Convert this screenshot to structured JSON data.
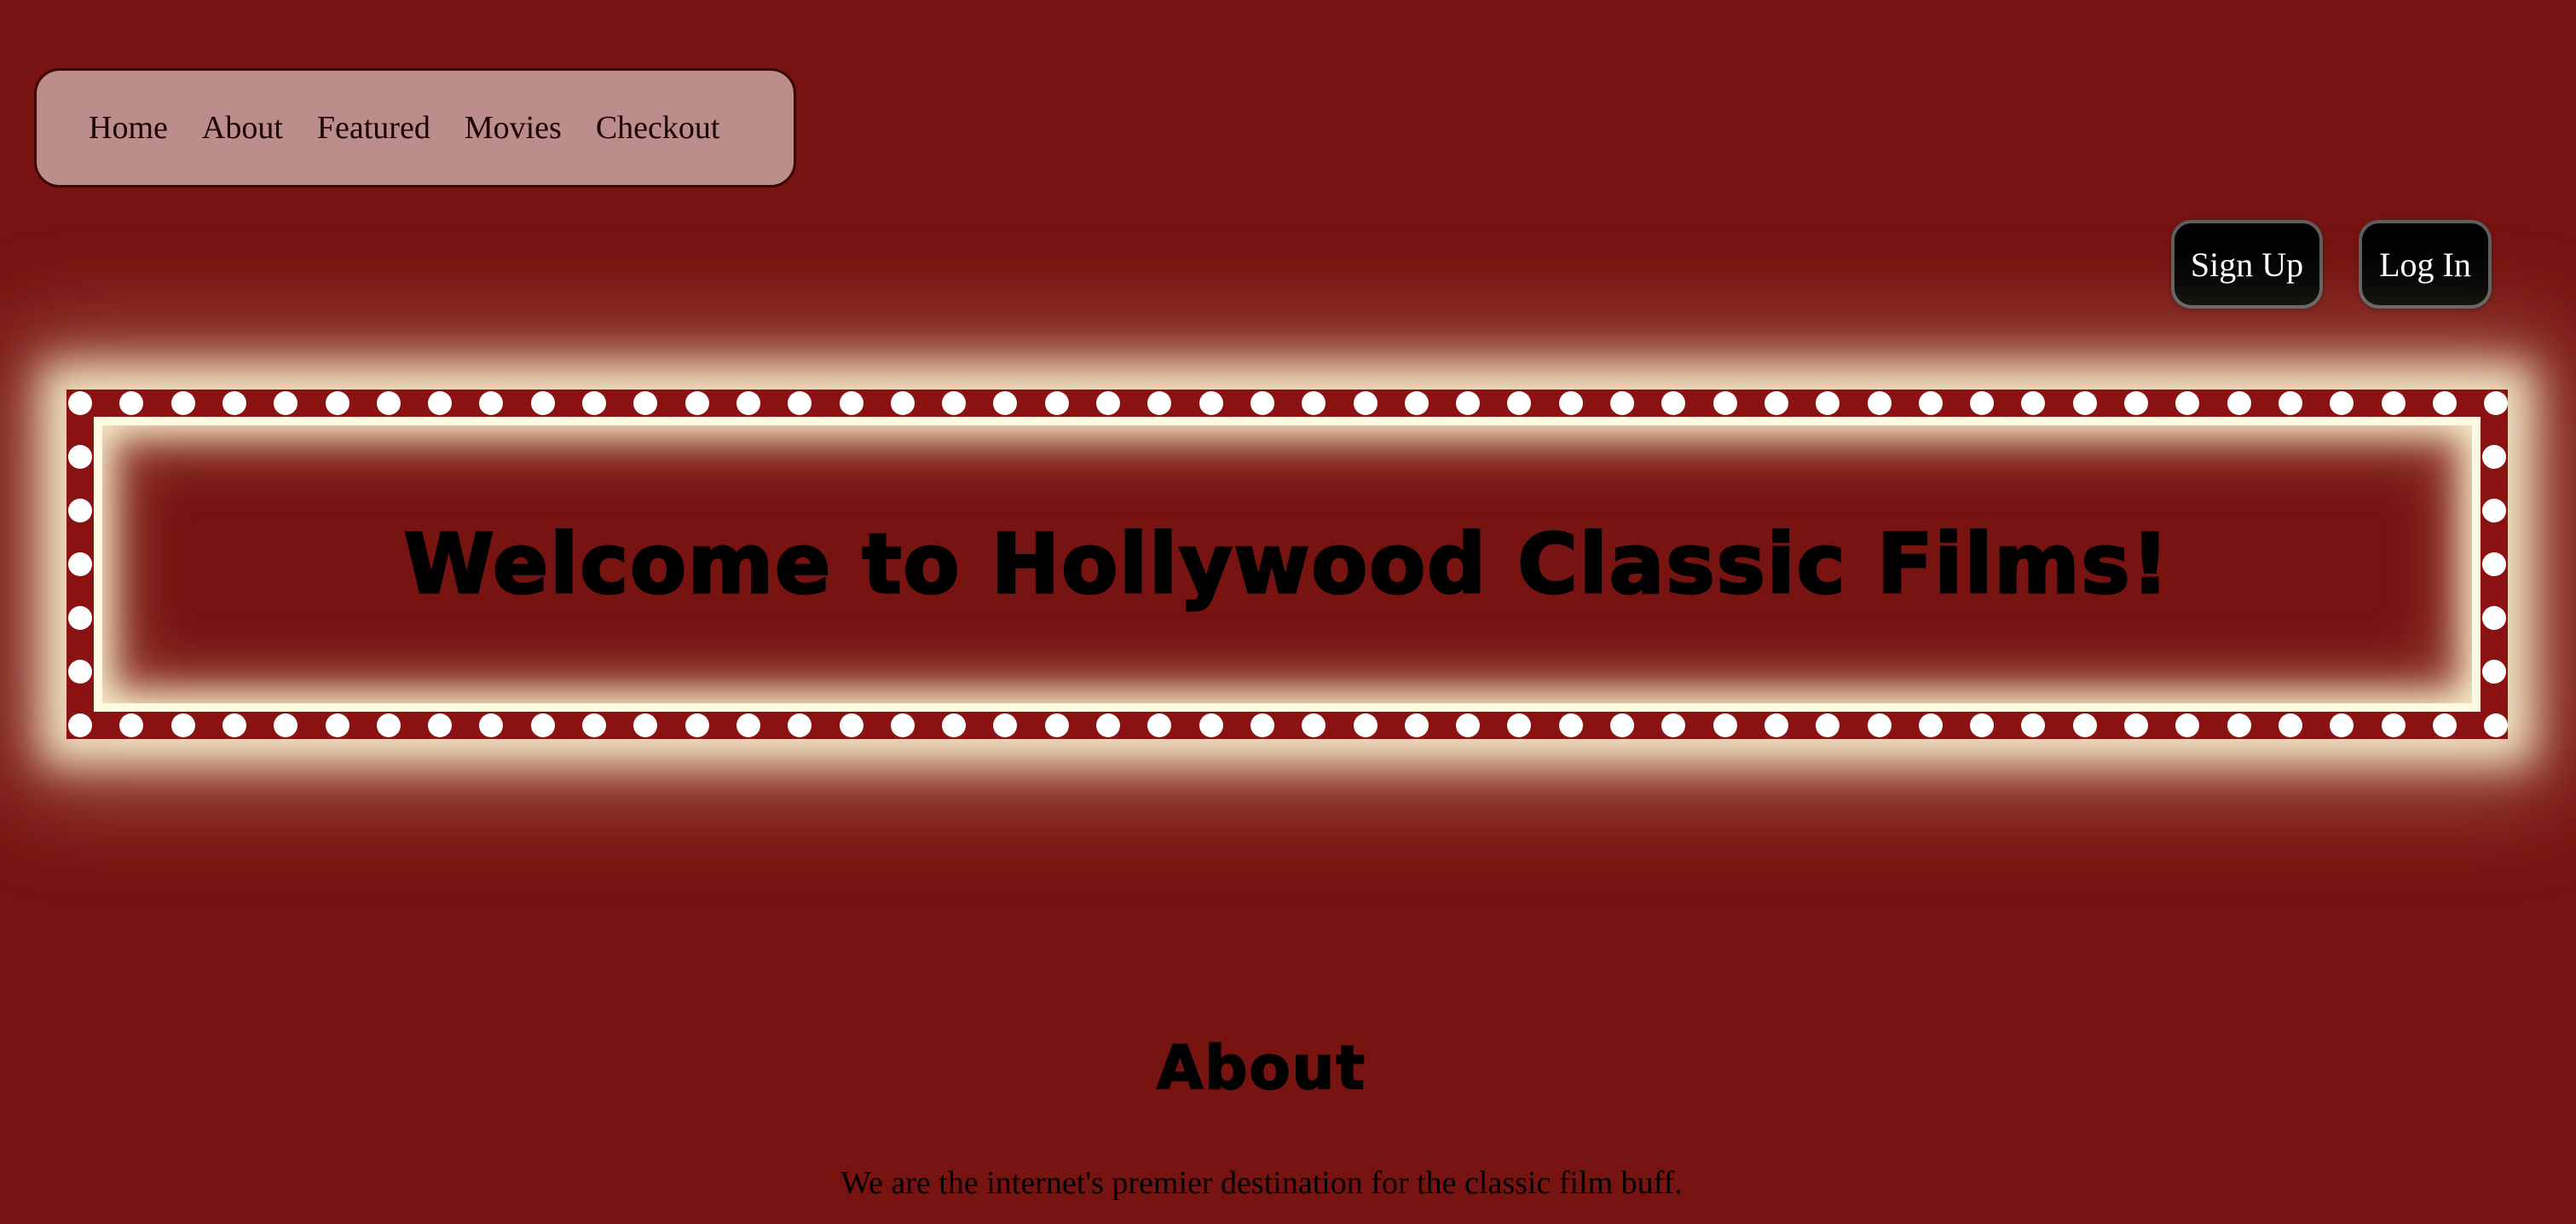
{
  "nav": {
    "items": [
      {
        "label": "Home"
      },
      {
        "label": "About"
      },
      {
        "label": "Featured"
      },
      {
        "label": "Movies"
      },
      {
        "label": "Checkout"
      }
    ]
  },
  "auth": {
    "signup_label": "Sign Up",
    "login_label": "Log In"
  },
  "hero": {
    "title": "Welcome to Hollywood Classic Films!"
  },
  "about": {
    "heading": "About",
    "text": "We are the internet's premier destination for the classic film buff."
  },
  "colors": {
    "page_background": "#771310",
    "nav_background": "#bb8d8b",
    "marquee_frame": "#8a1212",
    "marquee_glow": "#fffbe2",
    "bulb": "#ffffff",
    "button_background": "#000000"
  }
}
